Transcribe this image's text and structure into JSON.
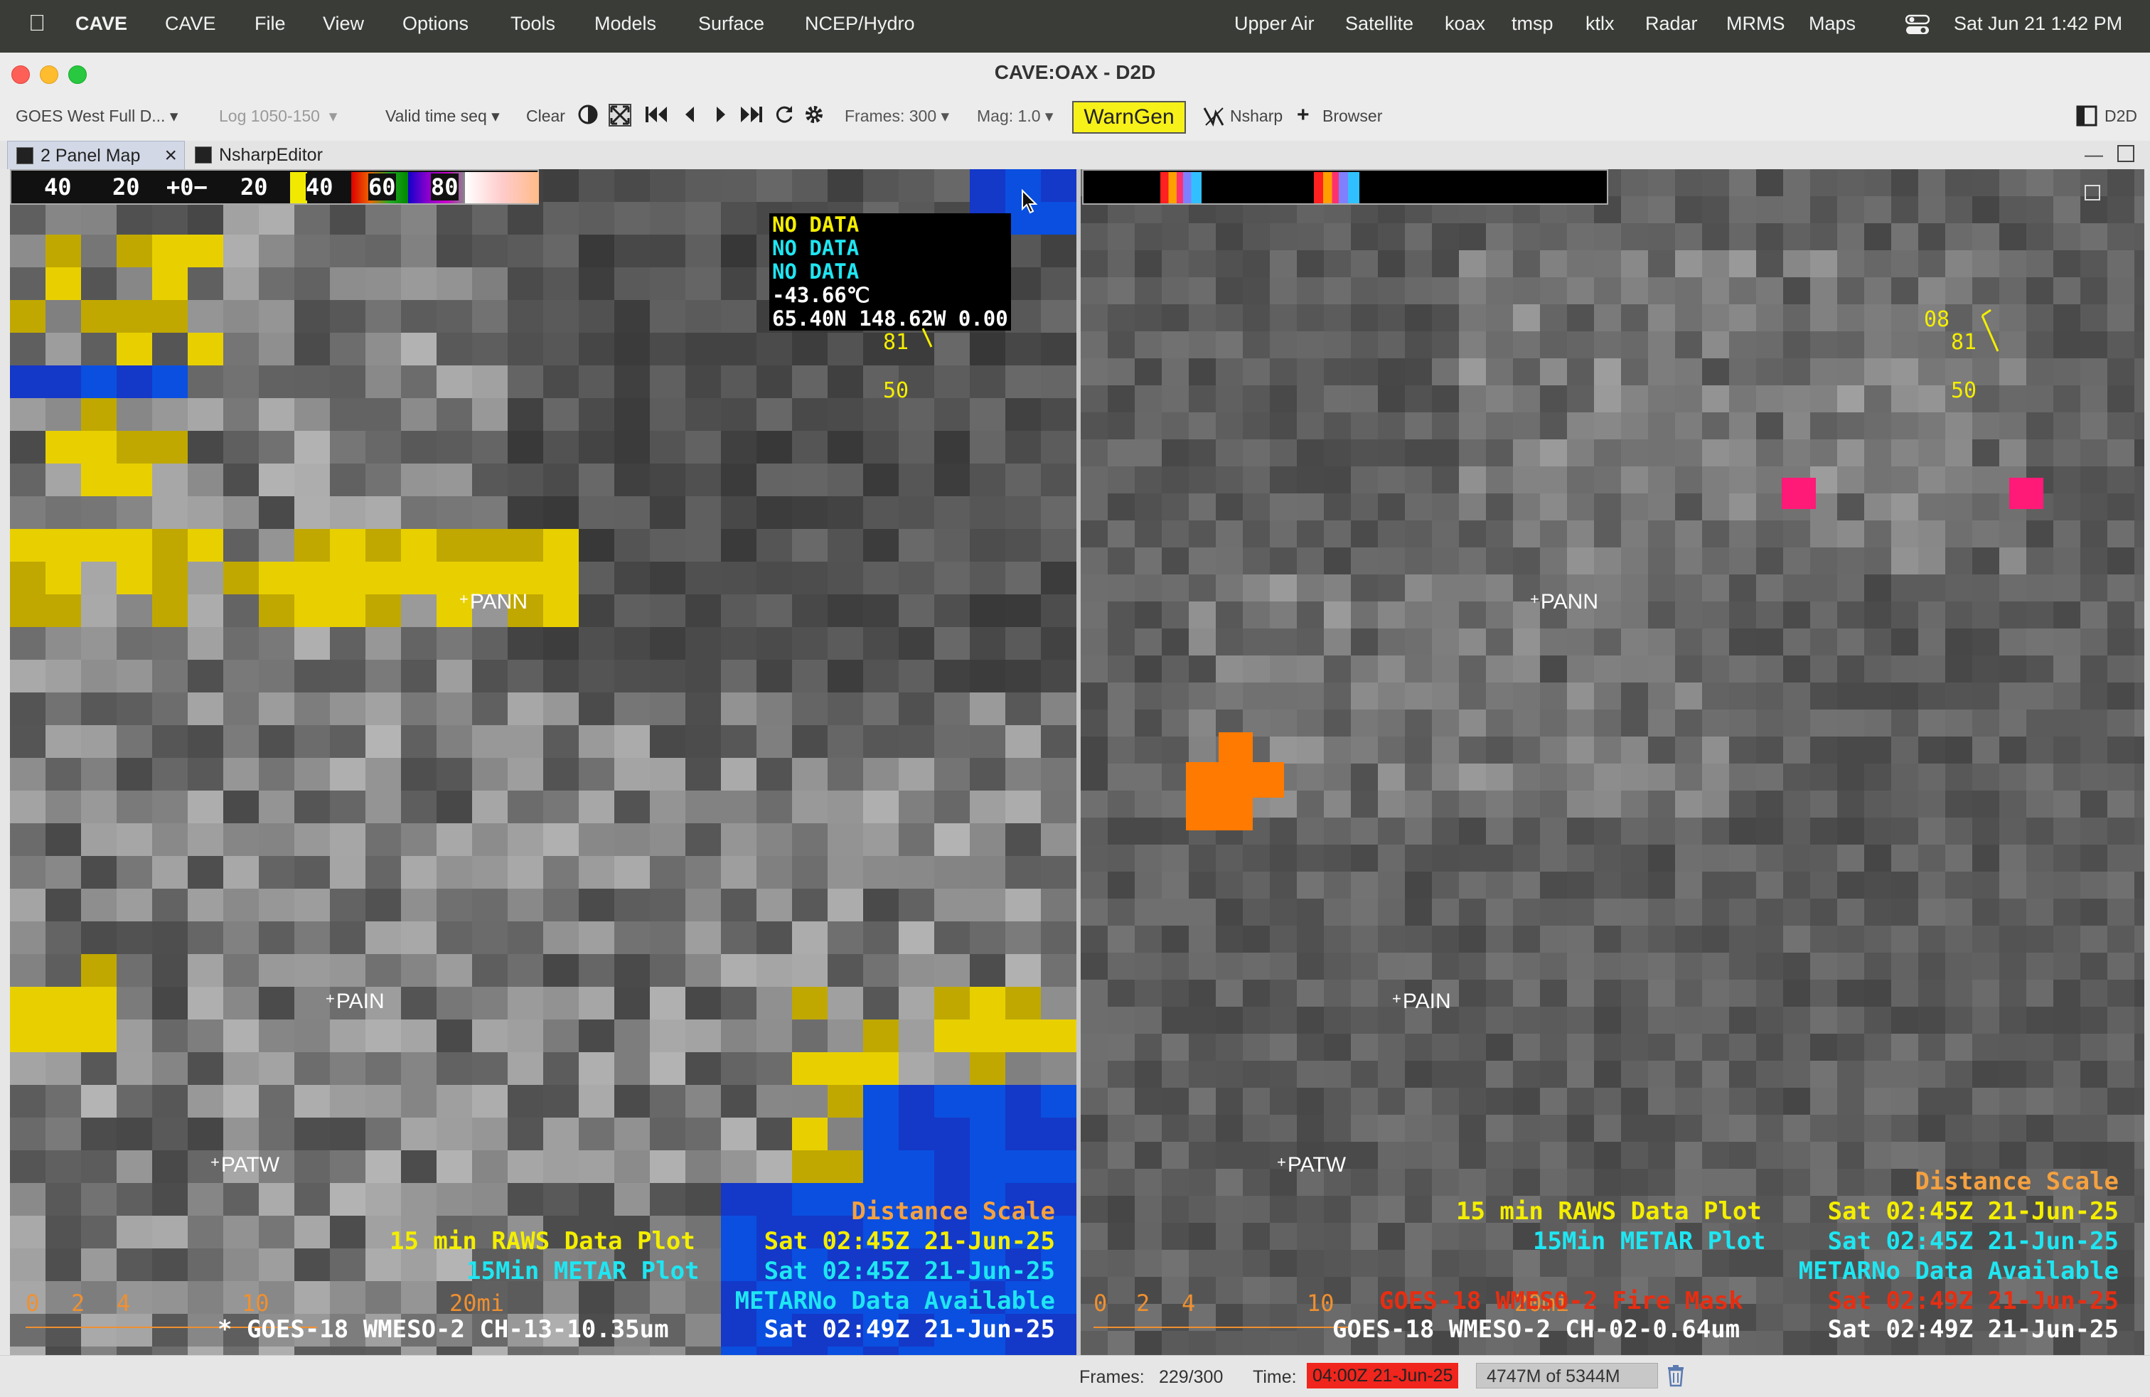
{
  "menubar": {
    "app_name": "CAVE",
    "items": [
      "CAVE",
      "File",
      "View",
      "Options",
      "Tools",
      "Models",
      "Surface",
      "NCEP/Hydro",
      "Upper Air",
      "Satellite",
      "koax",
      "tmsp",
      "ktlx",
      "Radar",
      "MRMS",
      "Maps"
    ],
    "datetime": "Sat Jun 21  1:42 PM"
  },
  "window": {
    "title": "CAVE:OAX - D2D"
  },
  "toolbar": {
    "source_select": "GOES West Full D...",
    "log_select": "Log 1050-150",
    "valid_time_select": "Valid time seq",
    "clear_label": "Clear",
    "frames_select": "Frames: 300",
    "mag_select": "Mag: 1.0",
    "warngen_label": "WarnGen",
    "nsharp_label": "Nsharp",
    "browser_label": "Browser",
    "perspective_label": "D2D"
  },
  "tabs": [
    {
      "label": "2 Panel Map"
    },
    {
      "label": "NsharpEditor"
    }
  ],
  "left_panel": {
    "colorbar_labels": [
      "40",
      "20",
      "+0−",
      "20",
      "40",
      "60",
      "80"
    ],
    "sample_readout": [
      "NO DATA",
      "NO DATA",
      "NO DATA",
      "-43.66℃",
      "65.40N 148.62W 0.00"
    ],
    "wind_label_1": "81",
    "wind_label_2": "50",
    "stations": [
      "PANN",
      "PAIN",
      "PATW"
    ],
    "scale_ticks": [
      "0",
      "2",
      "4",
      "10",
      "20mi"
    ],
    "legend": [
      {
        "text": "Distance Scale",
        "time": ""
      },
      {
        "text": "15 min RAWS Data Plot",
        "time": "Sat 02:45Z 21-Jun-25"
      },
      {
        "text": "15Min METAR Plot",
        "time": "Sat 02:45Z 21-Jun-25"
      },
      {
        "text": "METARNo Data Available",
        "time": ""
      },
      {
        "text": "* GOES-18 WMESO-2 CH-13-10.35um",
        "time": "Sat 02:49Z 21-Jun-25"
      }
    ]
  },
  "right_panel": {
    "wind_label_top": "08",
    "wind_label_1": "81",
    "wind_label_2": "50",
    "stations": [
      "PANN",
      "PAIN",
      "PATW"
    ],
    "scale_ticks": [
      "0",
      "2",
      "4",
      "10",
      "20mi"
    ],
    "legend": [
      {
        "text": "Distance Scale",
        "time": ""
      },
      {
        "text": "15 min RAWS Data Plot",
        "time": "Sat 02:45Z 21-Jun-25"
      },
      {
        "text": "15Min METAR Plot",
        "time": "Sat 02:45Z 21-Jun-25"
      },
      {
        "text": "METARNo Data Available",
        "time": ""
      },
      {
        "text": "GOES-18 WMESO-2 Fire Mask",
        "time": "Sat 02:49Z 21-Jun-25"
      },
      {
        "text": "GOES-18 WMESO-2 CH-02-0.64um",
        "time": "Sat 02:49Z 21-Jun-25"
      }
    ]
  },
  "statusbar": {
    "frames_label": "Frames:",
    "frames_value": "229/300",
    "time_label": "Time:",
    "time_value": "04:00Z 21-Jun-25",
    "memory": "4747M of 5344M"
  },
  "colors": {
    "yellow": "#e8d000",
    "blue": "#0a4fe0",
    "cyan": "#1fe6f2",
    "orange": "#ff7a00",
    "magenta": "#ff1a78",
    "fire_red": "#e62e12",
    "warngen_bg": "#f7f11a",
    "time_bg": "#f0251d"
  }
}
